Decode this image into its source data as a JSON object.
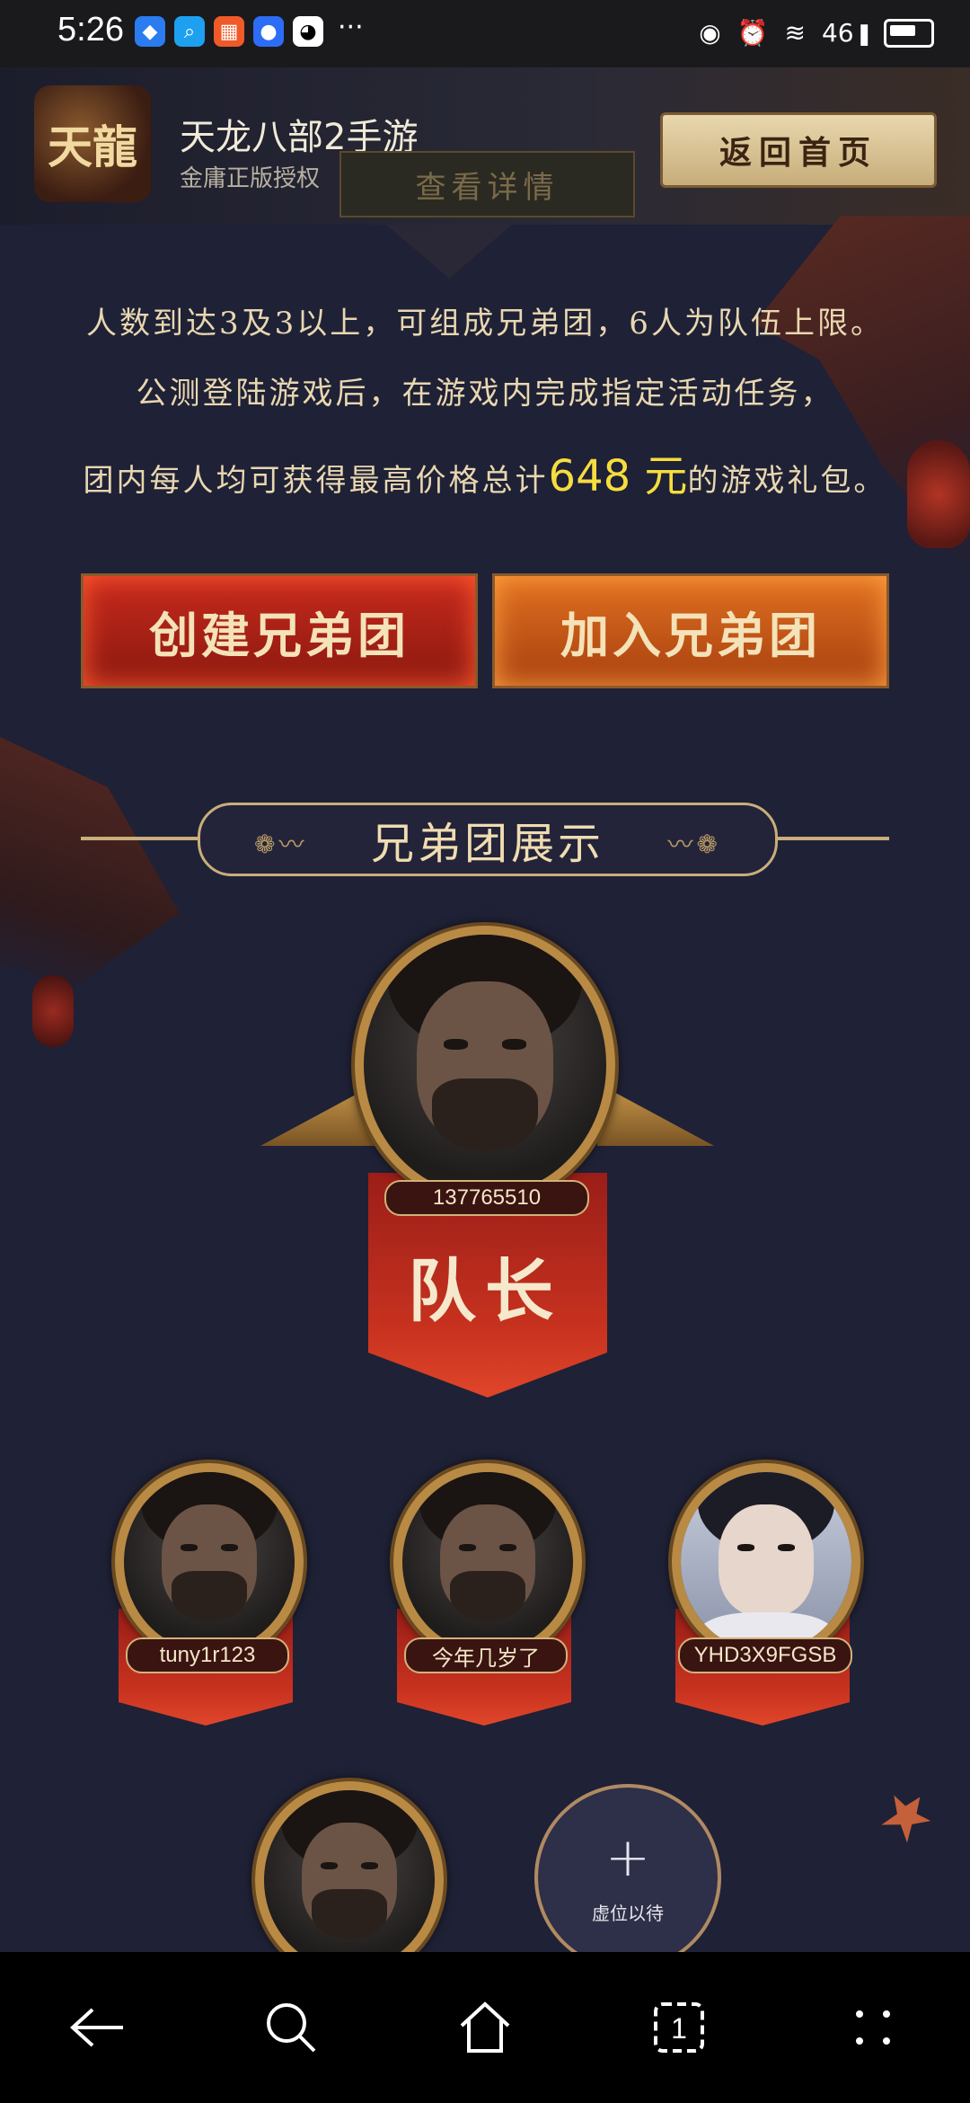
{
  "statusbar": {
    "time": "5:26",
    "more": "···",
    "network": "46"
  },
  "banner": {
    "logo_text": "天龍",
    "title": "天龙八部2手游",
    "subtitle": "金庸正版授权",
    "detail_button": "查看详情",
    "home_button": "返回首页"
  },
  "description": {
    "line1": "人数到达3及3以上，可组成兄弟团，6人为队伍上限。",
    "line2": "公测登陆游戏后，在游戏内完成指定活动任务，",
    "line3_prefix": "团内每人均可获得最高价格总计",
    "line3_amount": "648 元",
    "line3_suffix": "的游戏礼包。"
  },
  "actions": {
    "create": "创建兄弟团",
    "join": "加入兄弟团"
  },
  "section_title": "兄弟团展示",
  "leader": {
    "name": "137765510",
    "label": "队长"
  },
  "members": [
    {
      "name": "tuny1r123"
    },
    {
      "name": "今年几岁了"
    },
    {
      "name": "YHD3X9FGSB"
    }
  ],
  "empty_slot": {
    "label": "虚位以待"
  },
  "colors": {
    "background": "#1f2136",
    "amount_highlight": "#f7dd3e",
    "create_button": "#c72a1c",
    "join_button": "#e07020",
    "gold_frame": "#b98a44"
  }
}
